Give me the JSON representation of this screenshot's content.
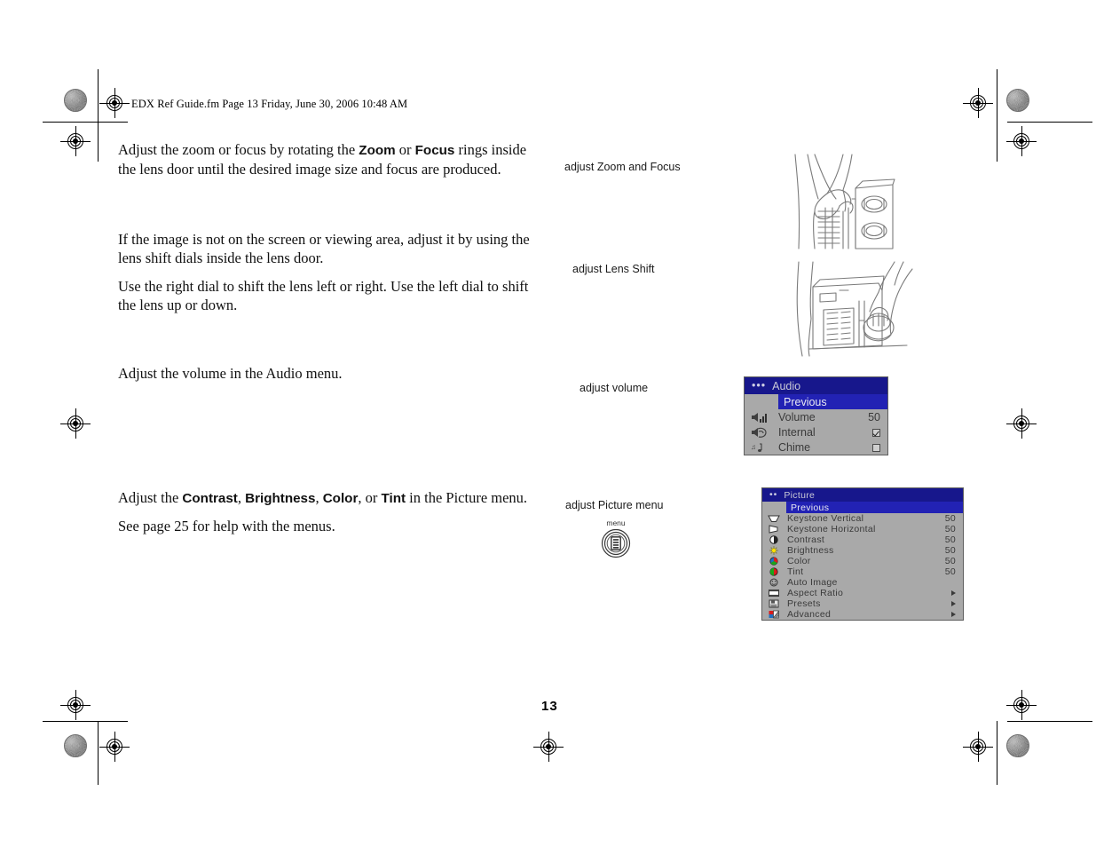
{
  "header": {
    "file_info": "EDX Ref Guide.fm  Page 13  Friday, June 30, 2006  10:48 AM"
  },
  "body": {
    "paragraphs": [
      {
        "id": "zoom-focus",
        "text_before": "Adjust the zoom or focus by rotating the ",
        "bold1": "Zoom",
        "text_mid": " or ",
        "bold2": "Focus",
        "text_after": " rings inside the lens door until the desired image size and focus are produced."
      },
      {
        "id": "lens-shift-1",
        "text": "If the image is not on the screen or viewing area, adjust it by using the lens shift dials inside the lens door."
      },
      {
        "id": "lens-shift-2",
        "text": "Use the right dial to shift the lens left or right. Use the left dial to shift the lens up or down."
      },
      {
        "id": "volume",
        "text": "Adjust the volume in the Audio menu."
      },
      {
        "id": "picture-intro",
        "text_before": "Adjust the ",
        "bold1": "Contrast",
        "sep1": ", ",
        "bold2": "Brightness",
        "sep2": ", ",
        "bold3": "Color",
        "sep3": ", or ",
        "bold4": "Tint",
        "text_after": " in the Picture menu."
      },
      {
        "id": "see-page",
        "text": "See page 25 for help with the menus."
      }
    ]
  },
  "captions": [
    {
      "id": "zoom-focus",
      "label": "adjust Zoom and Focus"
    },
    {
      "id": "lens-shift",
      "label": "adjust Lens Shift"
    },
    {
      "id": "volume",
      "label": "adjust volume"
    },
    {
      "id": "picture-menu",
      "label": "adjust Picture menu"
    }
  ],
  "menu_button": {
    "label": "menu",
    "icon": "menu-button-icon"
  },
  "audio_menu": {
    "title": "Audio",
    "dots": "•••",
    "previous": "Previous",
    "rows": [
      {
        "icon": "volume-icon",
        "label": "Volume",
        "value": "50",
        "type": "number"
      },
      {
        "icon": "internal-speaker-icon",
        "label": "Internal",
        "value": "checked",
        "type": "checkbox"
      },
      {
        "icon": "chime-note-icon",
        "label": "Chime",
        "value": "unchecked",
        "type": "checkbox"
      }
    ]
  },
  "picture_menu": {
    "title": "Picture",
    "dots": "••",
    "previous": "Previous",
    "rows": [
      {
        "icon": "keystone-vertical-icon",
        "label": "Keystone  Vertical",
        "value": "50",
        "type": "number"
      },
      {
        "icon": "keystone-horizontal-icon",
        "label": "Keystone  Horizontal",
        "value": "50",
        "type": "number"
      },
      {
        "icon": "contrast-icon",
        "label": "Contrast",
        "value": "50",
        "type": "number"
      },
      {
        "icon": "brightness-icon",
        "label": "Brightness",
        "value": "50",
        "type": "number"
      },
      {
        "icon": "color-icon",
        "label": "Color",
        "value": "50",
        "type": "number"
      },
      {
        "icon": "tint-icon",
        "label": "Tint",
        "value": "50",
        "type": "number"
      },
      {
        "icon": "auto-image-icon",
        "label": "Auto  Image",
        "value": "",
        "type": "none"
      },
      {
        "icon": "aspect-ratio-icon",
        "label": "Aspect  Ratio",
        "value": "",
        "type": "submenu"
      },
      {
        "icon": "presets-icon",
        "label": "Presets",
        "value": "",
        "type": "submenu"
      },
      {
        "icon": "advanced-icon",
        "label": "Advanced",
        "value": "",
        "type": "submenu"
      }
    ]
  },
  "footer": {
    "page_number": "13"
  },
  "illustrations": [
    {
      "id": "zoom-focus-hand",
      "alt": "hand adjusting zoom and focus rings inside lens door"
    },
    {
      "id": "lens-shift-hand",
      "alt": "hand adjusting lens shift dials inside lens door"
    }
  ],
  "colors": {
    "osd_title_bg": "#17178c",
    "osd_highlight_bg": "#2222b4",
    "osd_body_bg": "#a9a9a9",
    "osd_text": "#3a3a3a"
  }
}
